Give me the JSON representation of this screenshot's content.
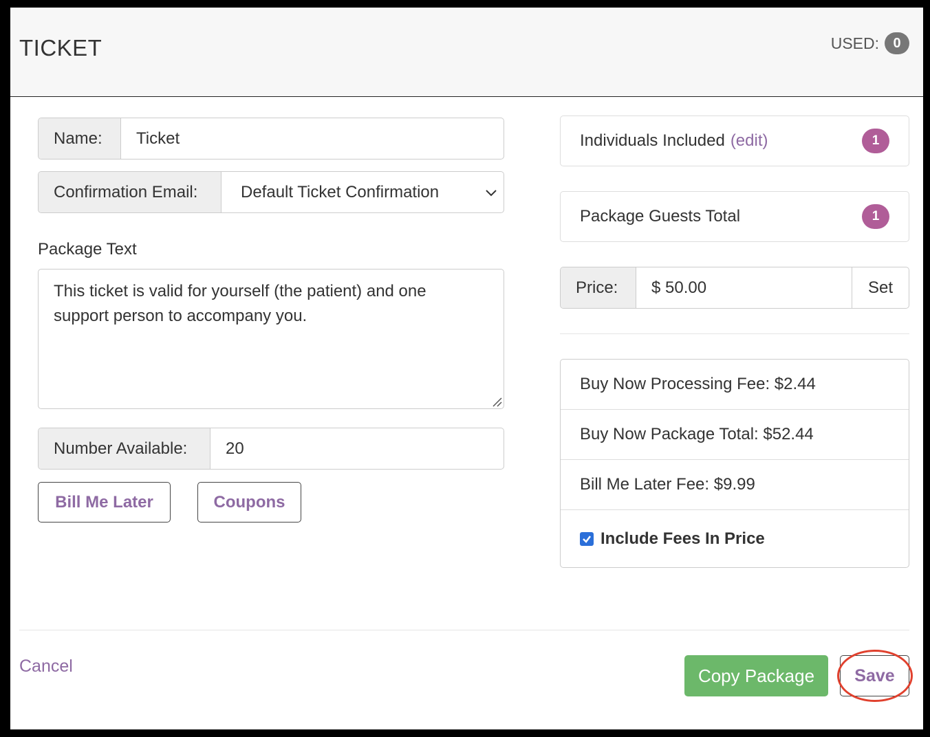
{
  "header": {
    "title": "TICKET",
    "used_label": "USED:",
    "used_count": "0"
  },
  "form": {
    "name_label": "Name:",
    "name_value": "Ticket",
    "confirmation_label": "Confirmation Email:",
    "confirmation_value": "Default Ticket Confirmation",
    "package_text_label": "Package Text",
    "package_text_line1": "This ticket is valid for yourself (the patient) and one",
    "package_text_line2": "support person to accompany you.",
    "number_label": "Number Available:",
    "number_value": "20",
    "bill_me_later_label": "Bill Me Later",
    "coupons_label": "Coupons"
  },
  "side": {
    "individuals_label": "Individuals Included",
    "individuals_edit": "(edit)",
    "individuals_count": "1",
    "guests_label": "Package Guests Total",
    "guests_count": "1",
    "price_label": "Price:",
    "price_value": "$ 50.00",
    "set_label": "Set",
    "fees": [
      "Buy Now Processing Fee: $2.44",
      "Buy Now Package Total: $52.44",
      "Bill Me Later Fee: $9.99"
    ],
    "include_fees_label": "Include Fees In Price",
    "include_fees_checked": true
  },
  "footer": {
    "cancel_label": "Cancel",
    "copy_label": "Copy Package",
    "save_label": "Save"
  },
  "colors": {
    "accent": "#8e6aa3",
    "badge": "#b05d98",
    "green": "#6cb86a",
    "highlight": "#e0412e"
  }
}
